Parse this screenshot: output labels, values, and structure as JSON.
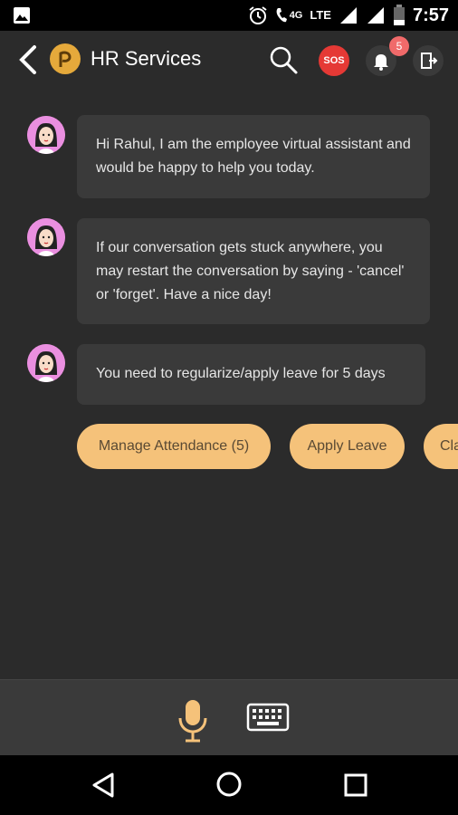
{
  "status_bar": {
    "time": "7:57",
    "network": "LTE",
    "call_network": "4G",
    "icons": [
      "image-notification-icon",
      "alarm-icon",
      "volte-call-icon",
      "signal-icon",
      "signal-icon",
      "battery-icon"
    ]
  },
  "header": {
    "title": "HR Services",
    "sos_label": "SOS",
    "notification_count": "5",
    "icons": [
      "back-arrow-icon",
      "brand-logo",
      "search-icon",
      "bell-icon",
      "exit-icon"
    ]
  },
  "chat": {
    "messages": [
      {
        "text": "Hi Rahul, I am the employee virtual assistant and would be happy to help you today."
      },
      {
        "text": "If our conversation gets stuck anywhere, you may restart the conversation by saying - 'cancel' or 'forget'. Have a nice day!"
      },
      {
        "text": "You need to regularize/apply leave for 5 days"
      }
    ],
    "quick_replies": [
      {
        "label": "Manage Attendance (5)"
      },
      {
        "label": "Apply Leave"
      },
      {
        "label": "Cla"
      }
    ]
  },
  "input_bar": {
    "icons": [
      "microphone-icon",
      "keyboard-icon"
    ],
    "accent_color": "#f5c27a"
  },
  "nav_bar": {
    "icons": [
      "nav-back-icon",
      "nav-home-icon",
      "nav-recent-icon"
    ]
  },
  "colors": {
    "background": "#2b2b2b",
    "bubble": "#3a3a3a",
    "chip": "#f5c27a",
    "sos": "#e53935",
    "badge": "#f06a6a"
  }
}
